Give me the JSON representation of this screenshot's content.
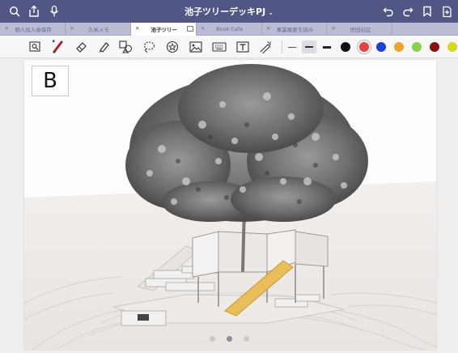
{
  "window": {
    "title": "池子ツリーデッキPJ",
    "title_caret": "⌄",
    "icons_left": [
      "search-icon",
      "share-icon",
      "voice-icon"
    ],
    "icons_right": [
      "undo-icon",
      "redo-icon",
      "bookmark-icon",
      "add-page-icon"
    ]
  },
  "tabs": [
    {
      "label": "個人加入者保存",
      "active": false
    },
    {
      "label": "久米メモ",
      "active": false
    },
    {
      "label": "池子ツリー",
      "active": true
    },
    {
      "label": "Book Cafe",
      "active": false
    },
    {
      "label": "事業概要を読み",
      "active": false
    },
    {
      "label": "世田谷区",
      "active": false
    },
    {
      "label": "",
      "active": false
    }
  ],
  "toolbar": {
    "tools": [
      "lasso-zoom-tool",
      "pen-tool",
      "eraser-tool",
      "highlighter-tool",
      "shapes-tool",
      "lasso-tool",
      "sticker-tool",
      "image-tool",
      "keyboard-tool",
      "text-tool",
      "laser-pointer-tool"
    ],
    "line_widths": [
      "thin",
      "medium",
      "thick"
    ],
    "selected_line_width": "medium",
    "colors": [
      "#111111",
      "#e8423f",
      "#1f3fd6",
      "#f0a22e",
      "#8ad04a",
      "#8a1010",
      "#d6d61a"
    ],
    "selected_color": "#e8423f"
  },
  "page": {
    "boxed_letter": "B",
    "image_alt": "treehouse-rendering",
    "pagination": {
      "count": 3,
      "current": 2
    }
  }
}
